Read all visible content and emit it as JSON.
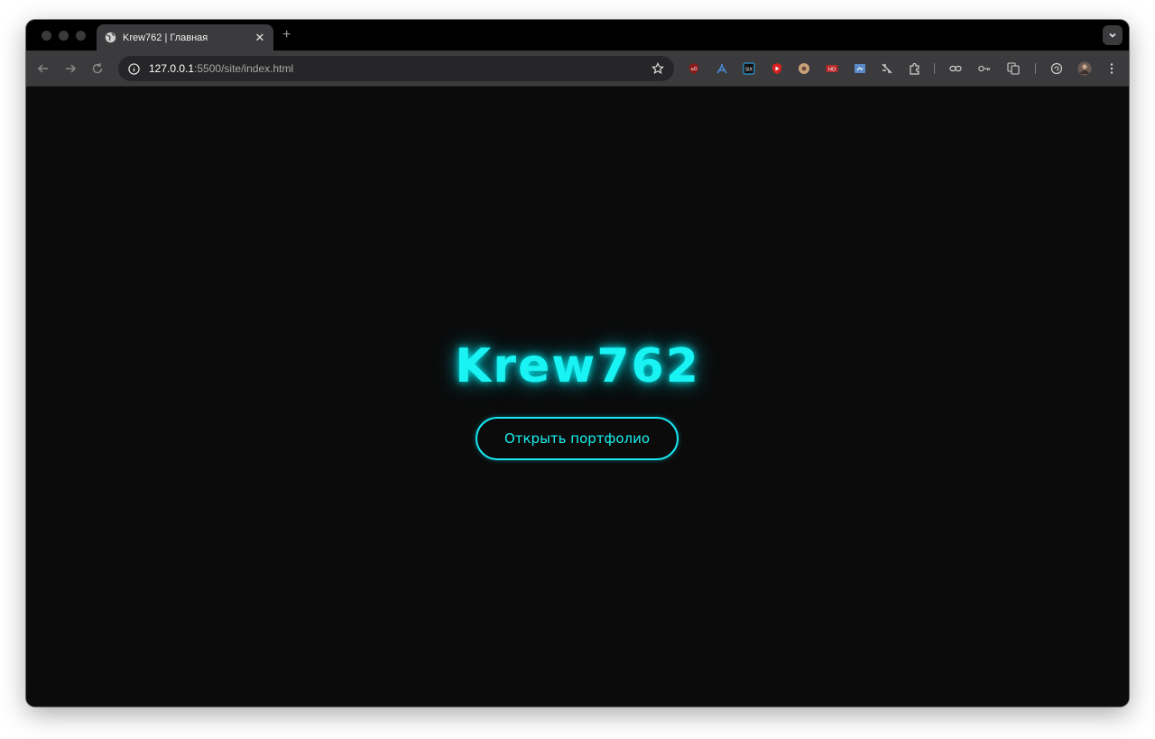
{
  "browser": {
    "tab": {
      "title": "Krew762 | Главная",
      "close_glyph": "✕",
      "favicon": "globe-icon"
    },
    "new_tab_glyph": "+",
    "address": {
      "host": "127.0.0.1",
      "path": ":5500/site/index.html"
    },
    "extensions": [
      "ublock-icon",
      "acrobat-icon",
      "six-icon",
      "youtube-icon",
      "pokeball-icon",
      "hd-icon",
      "screen-icon",
      "shield-tools-icon",
      "puzzle-icon",
      "link-icon",
      "key-icon",
      "translate-icon",
      "refresh-circle-icon",
      "profile-avatar"
    ]
  },
  "page": {
    "title": "Krew762",
    "cta_label": "Открыть портфолио"
  },
  "colors": {
    "accent": "#19f3f3",
    "page_bg": "#0b0b0b",
    "toolbar_bg": "#3b3b3d"
  }
}
